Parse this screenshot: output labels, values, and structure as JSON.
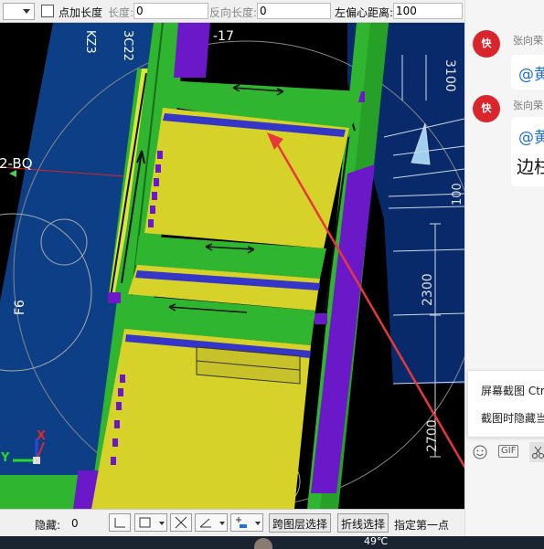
{
  "toolbar": {
    "checkbox_label": "点加长度",
    "length_label": "长度:",
    "length_value": "0",
    "reverse_label": "反向长度:",
    "reverse_value": "0",
    "left_offset_label": "左偏心距离:",
    "left_offset_value": "100"
  },
  "viewport": {
    "labels": {
      "kz": "KZ3",
      "c22": "3C22",
      "num17": "-17",
      "bq": "2-BQ",
      "f6": "F6",
      "d3100": "3100",
      "d100": "100",
      "d2300": "2300",
      "d2700": "2700"
    },
    "axis": {
      "x": "X",
      "y": "Y"
    }
  },
  "statusbar": {
    "hide_label": "隐藏:",
    "hide_value": "0",
    "cross_layer_button": "跨图层选择",
    "polyline_button": "折线选择",
    "specify_point": "指定第一点"
  },
  "chat": {
    "avatar_text": "快",
    "sender_1": "张向荣",
    "bubble_1": "@黄",
    "sender_2": "张向荣",
    "bubble_2_mention": "@黄",
    "bubble_2_text": "边柱",
    "menu": {
      "screenshot": "屏幕截图 Ctrl",
      "hide_while": "截图时隐藏当"
    },
    "tools": {
      "gif": "GIF"
    }
  },
  "taskbar": {
    "temperature": "49℃"
  }
}
